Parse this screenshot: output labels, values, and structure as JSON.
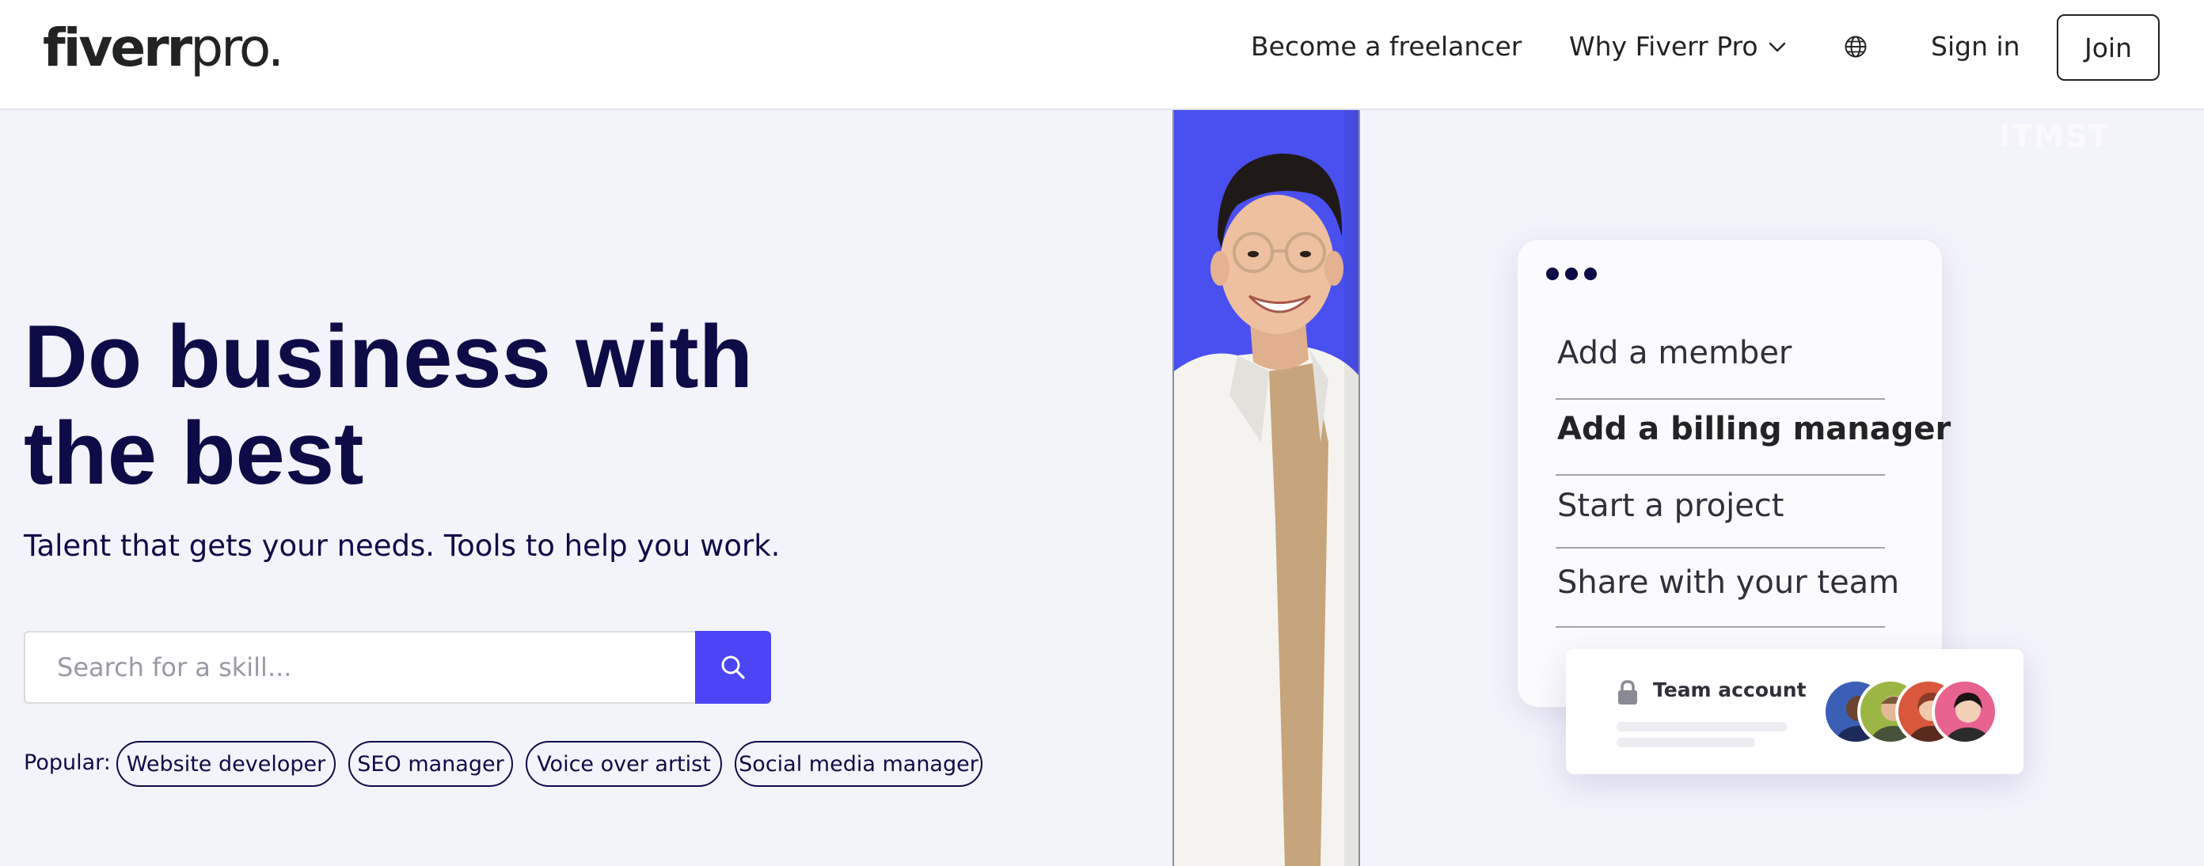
{
  "brand": {
    "logo_bold": "fiverr",
    "logo_light": "pro.",
    "accent": "#4c45f5",
    "navy": "#0d0c47"
  },
  "nav": {
    "become_freelancer": "Become a freelancer",
    "why_fiverr_pro": "Why Fiverr Pro",
    "why_icon": "chevron-down-icon",
    "language_icon": "globe-icon",
    "sign_in": "Sign in",
    "join": "Join"
  },
  "hero": {
    "headline_line1": "Do business with",
    "headline_line2": "the best",
    "subheadline": "Talent that gets your needs. Tools to help you work.",
    "search_placeholder": "Search for a skill...",
    "search_value": "",
    "search_icon": "search-icon",
    "popular_label": "Popular:",
    "popular_chips": [
      "Website developer",
      "SEO manager",
      "Voice over artist",
      "Social media manager"
    ]
  },
  "card": {
    "menu_icon": "more-dots-icon",
    "items": [
      "Add a member",
      "Add a billing manager",
      "Start a project",
      "Share with your team"
    ],
    "highlighted_item": "Add a billing manager"
  },
  "team": {
    "lock_icon": "lock-icon",
    "label": "Team account",
    "avatars": [
      "avatar-1",
      "avatar-2",
      "avatar-3",
      "avatar-4"
    ]
  },
  "watermark": "ITMST"
}
